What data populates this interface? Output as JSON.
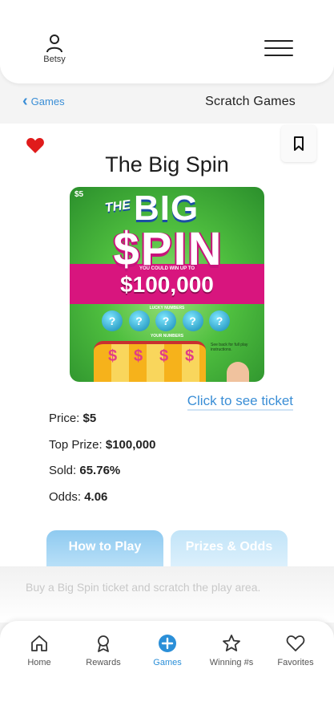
{
  "header": {
    "user_name": "Betsy",
    "menu_icon": "hamburger-menu-icon"
  },
  "breadcrumb": {
    "back_label": "Games",
    "title": "Scratch Games"
  },
  "game": {
    "title": "The Big Spin",
    "favorited": true,
    "ticket_art": {
      "price_tag": "$5",
      "the": "THE",
      "big": "BIG",
      "spin": "$PIN",
      "win_up_to": "YOU COULD WIN UP TO",
      "top_amount": "$100,000",
      "lucky_numbers": "LUCKY NUMBERS",
      "your_numbers": "YOUR NUMBERS",
      "ball_symbol": "?",
      "dollar_symbol": "$",
      "hint": "See back for full play instructions."
    },
    "see_ticket_link": "Click to see ticket",
    "details": {
      "price_label": "Price:",
      "price_value": "$5",
      "top_prize_label": "Top Prize:",
      "top_prize_value": "$100,000",
      "sold_label": "Sold:",
      "sold_value": "65.76%",
      "odds_label": "Odds:",
      "odds_value": "4.06"
    },
    "tabs": {
      "how_to_play": "How to Play",
      "prizes_odds": "Prizes & Odds"
    },
    "description": "Buy a Big Spin ticket and scratch the play area."
  },
  "bottom_nav": {
    "items": [
      {
        "label": "Home",
        "icon": "home-icon"
      },
      {
        "label": "Rewards",
        "icon": "medal-icon"
      },
      {
        "label": "Games",
        "icon": "plus-circle-icon"
      },
      {
        "label": "Winning #s",
        "icon": "star-icon"
      },
      {
        "label": "Favorites",
        "icon": "heart-icon"
      }
    ],
    "active": "Games"
  },
  "colors": {
    "accent_blue": "#3a8ed6",
    "heart_red": "#e01b1b",
    "tab_blue": "#8fcaf0"
  }
}
